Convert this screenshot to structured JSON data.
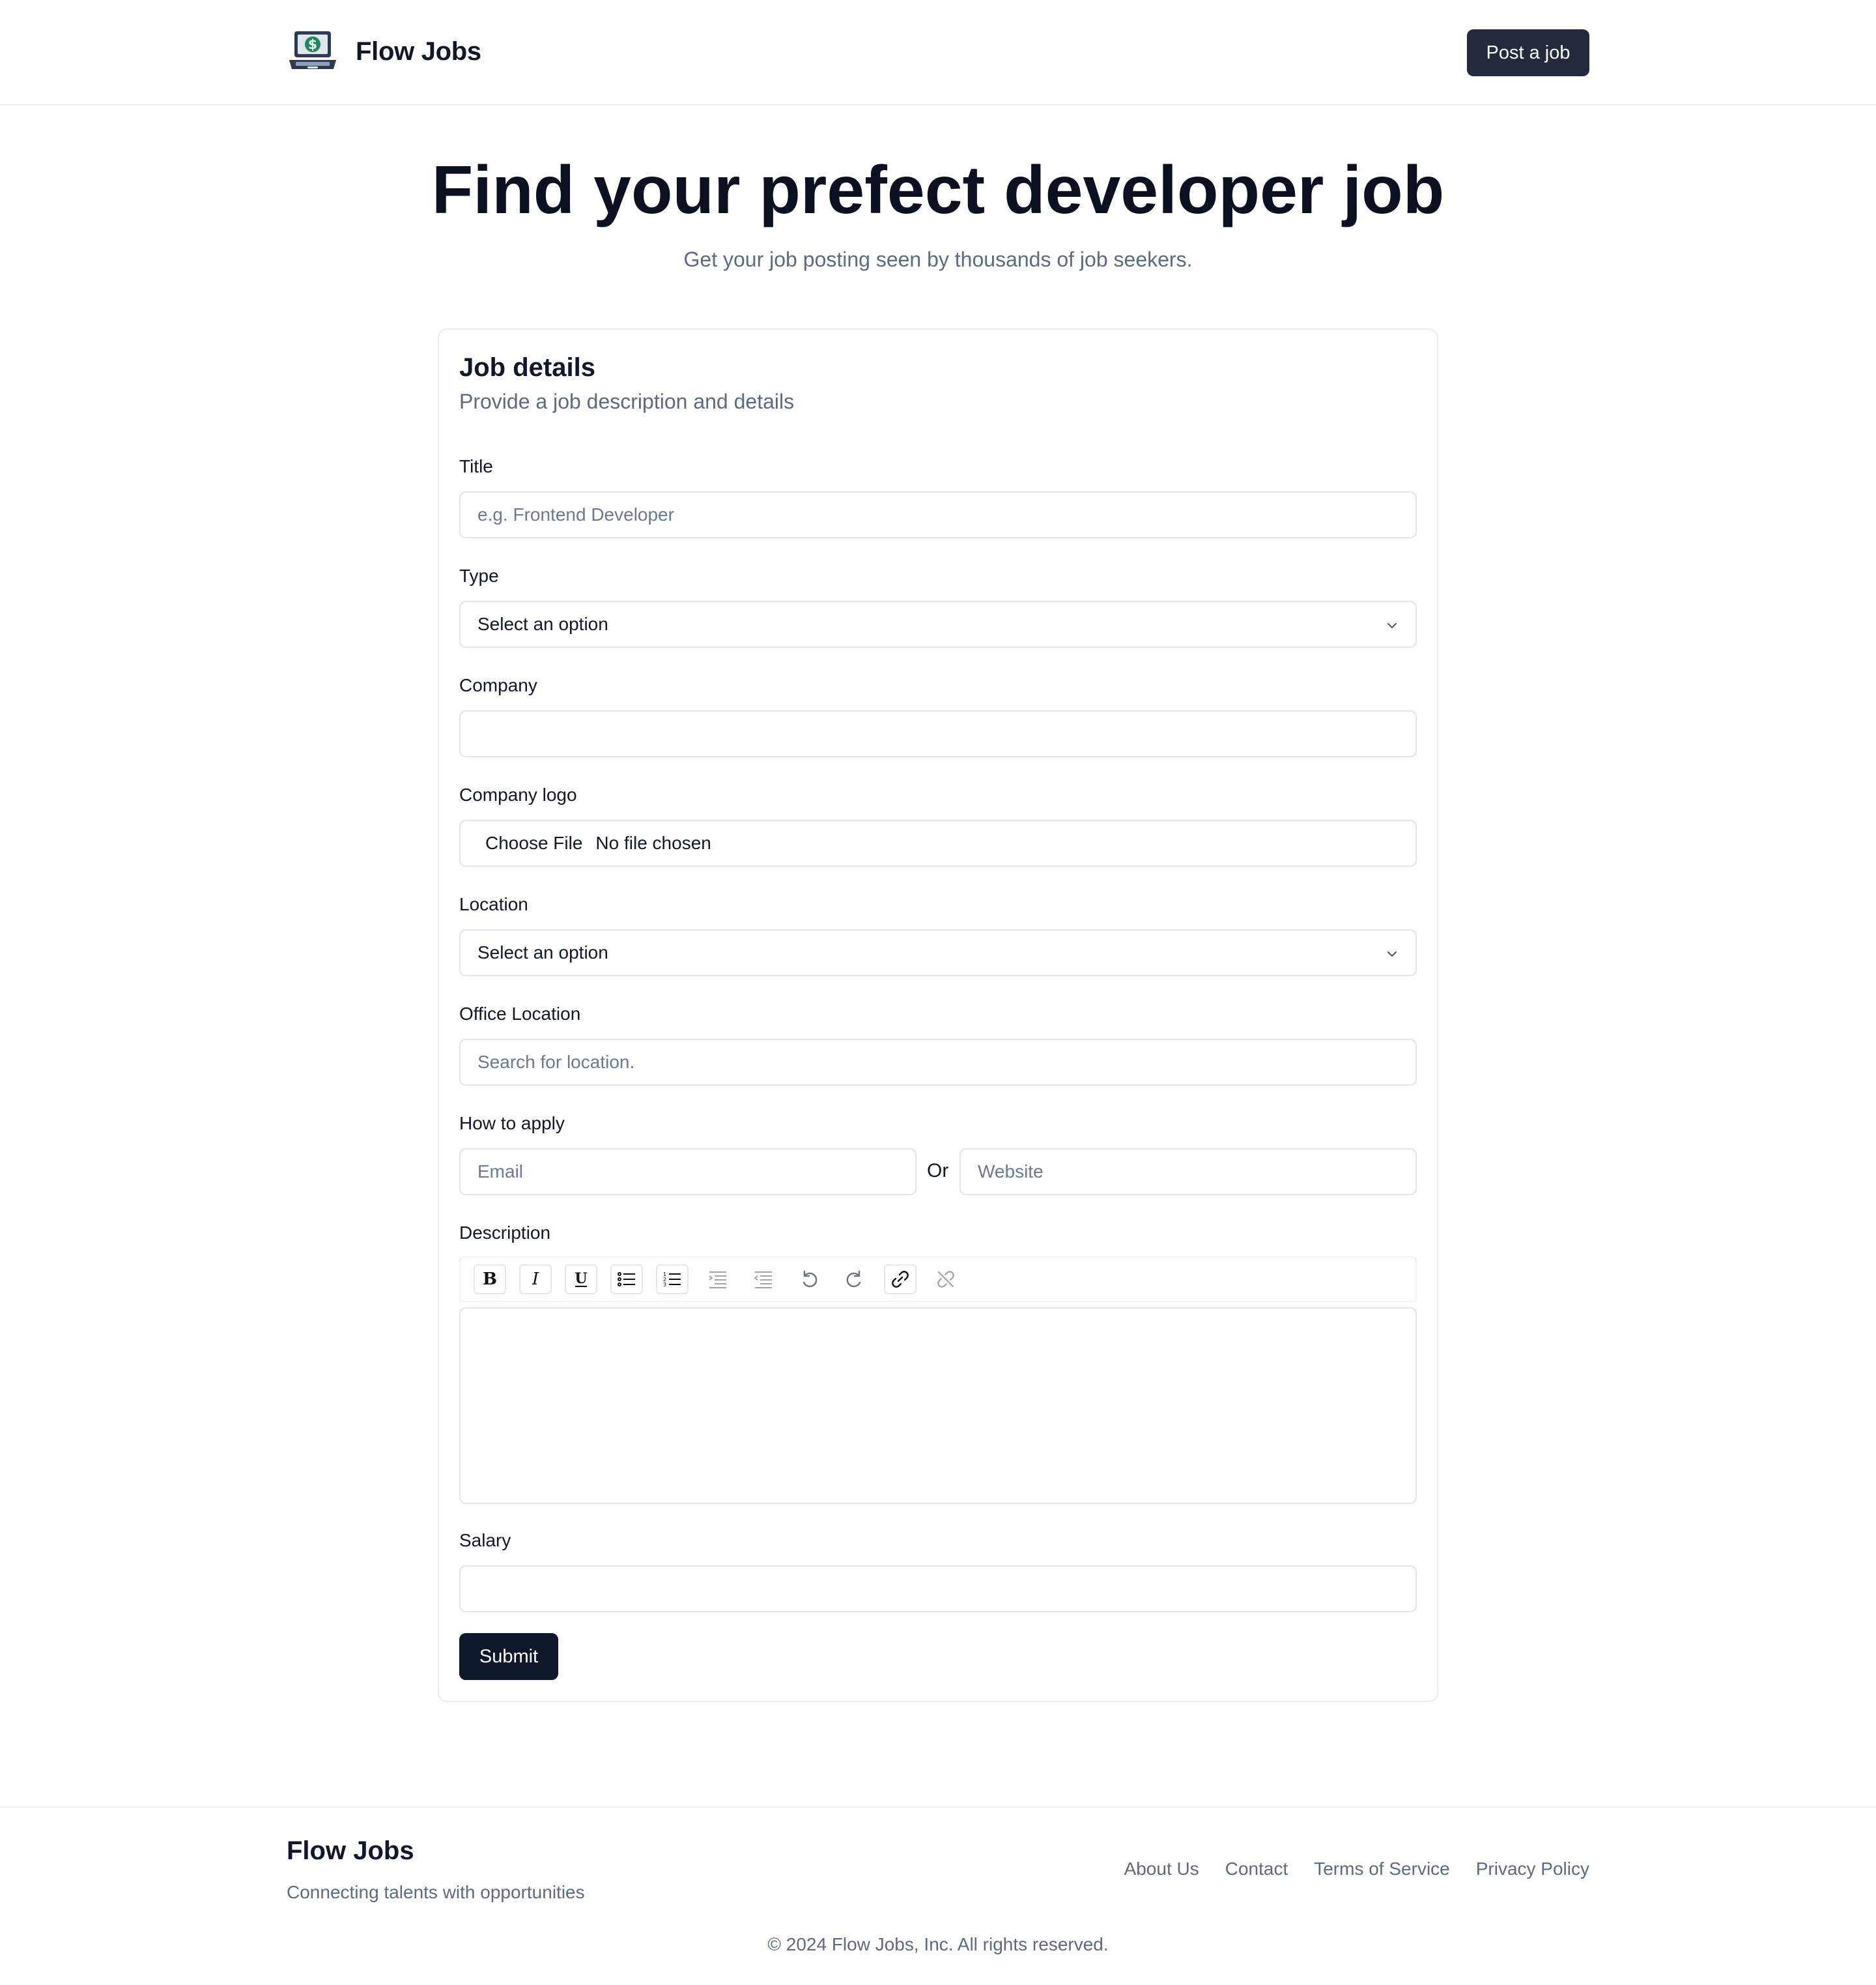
{
  "header": {
    "brand": "Flow Jobs",
    "post_button": "Post a job"
  },
  "hero": {
    "title": "Find your prefect developer job",
    "subtitle": "Get your job posting seen by thousands of job seekers."
  },
  "form": {
    "title": "Job details",
    "subtitle": "Provide a job description and details",
    "fields": {
      "title": {
        "label": "Title",
        "placeholder": "e.g. Frontend Developer"
      },
      "type": {
        "label": "Type",
        "value": "Select an option"
      },
      "company": {
        "label": "Company",
        "value": ""
      },
      "company_logo": {
        "label": "Company logo",
        "button": "Choose File",
        "status": "No file chosen"
      },
      "location": {
        "label": "Location",
        "value": "Select an option"
      },
      "office_location": {
        "label": "Office Location",
        "placeholder": "Search for location."
      },
      "how_to_apply": {
        "label": "How to apply",
        "email_placeholder": "Email",
        "or": "Or",
        "website_placeholder": "Website"
      },
      "description": {
        "label": "Description",
        "toolbar": [
          "bold-icon",
          "italic-icon",
          "underline-icon",
          "bullet-list-icon",
          "numbered-list-icon",
          "indent-icon",
          "outdent-icon",
          "undo-icon",
          "redo-icon",
          "link-icon",
          "unlink-icon"
        ]
      },
      "salary": {
        "label": "Salary",
        "value": ""
      }
    },
    "submit": "Submit"
  },
  "footer": {
    "brand": "Flow Jobs",
    "tagline": "Connecting talents with opportunities",
    "links": [
      "About Us",
      "Contact",
      "Terms of Service",
      "Privacy Policy"
    ],
    "copyright": "© 2024 Flow Jobs, Inc. All rights reserved."
  },
  "colors": {
    "primary_dark": "#0f172a",
    "button_dark": "#222a3b",
    "muted_text": "#5b6b82",
    "border": "#e2e6ec"
  }
}
